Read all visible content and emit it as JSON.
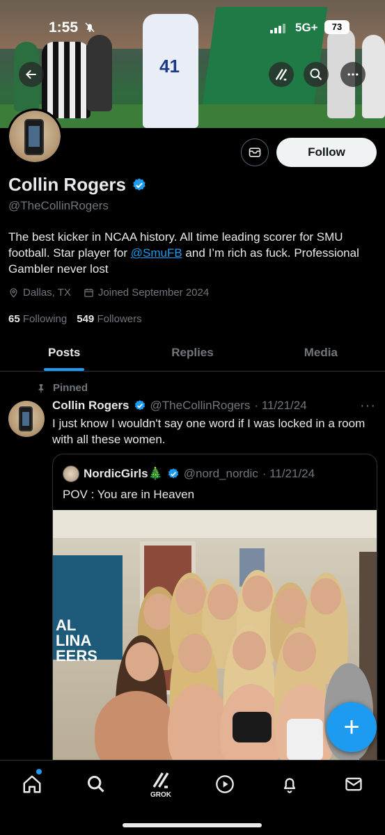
{
  "status_bar": {
    "time": "1:55",
    "network": "5G+",
    "battery": "73"
  },
  "header": {
    "back_icon": "arrow-left-icon",
    "grok_icon": "grok-icon",
    "search_icon": "search-icon",
    "more_icon": "more-horizontal-icon",
    "banner_jersey_number": "41"
  },
  "profile": {
    "name": "Collin Rogers",
    "handle": "@TheCollinRogers",
    "bio_before_link": "The best kicker in NCAA history. All time leading scorer for SMU football. Star player for ",
    "bio_link": "@SmuFB",
    "bio_after_link": " and I’m rich as fuck. Professional Gambler never lost",
    "location": "Dallas, TX",
    "joined": "Joined September 2024",
    "following_count": "65",
    "following_label": "Following",
    "followers_count": "549",
    "followers_label": "Followers",
    "follow_label": "Follow",
    "verified_color": "#1d9bf0"
  },
  "tabs": [
    {
      "label": "Posts",
      "active": true
    },
    {
      "label": "Replies",
      "active": false
    },
    {
      "label": "Media",
      "active": false
    }
  ],
  "post": {
    "pinned_label": "Pinned",
    "author_name": "Collin Rogers",
    "author_handle": "@TheCollinRogers",
    "date": "· 11/21/24",
    "more": "···",
    "text": "I just know I wouldn't say one word if I was locked in a room with all these women.",
    "quote": {
      "author_name": "NordicGirls🎄",
      "author_handle": "@nord_nordic",
      "date": "· 11/21/24",
      "text": "POV : You are in Heaven",
      "image_flag_text": "AL\nLINA\nEERS"
    }
  },
  "fab": {
    "label": "+"
  },
  "bottom_nav": {
    "items": [
      "home-icon",
      "search-icon",
      "grok-icon",
      "video-icon",
      "notifications-icon",
      "messages-icon"
    ],
    "grok_label": "GROK"
  },
  "colors": {
    "accent": "#1d9bf0",
    "background": "#000000",
    "text_primary": "#e7e9ea",
    "text_secondary": "#71767b",
    "border": "#2f3336"
  }
}
